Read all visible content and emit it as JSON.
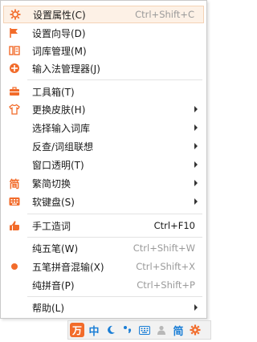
{
  "menu": {
    "items": [
      {
        "icon": "gear-icon",
        "label": "设置属性(C)",
        "shortcut": "Ctrl+Shift+C",
        "shortcut_dark": false,
        "submenu": false,
        "highlight": true
      },
      {
        "icon": "flag-icon",
        "label": "设置向导(D)",
        "shortcut": "",
        "shortcut_dark": false,
        "submenu": false,
        "highlight": false
      },
      {
        "icon": "dictionary-icon",
        "label": "词库管理(M)",
        "shortcut": "",
        "shortcut_dark": false,
        "submenu": false,
        "highlight": false
      },
      {
        "icon": "input-manager-icon",
        "label": "输入法管理器(J)",
        "shortcut": "",
        "shortcut_dark": false,
        "submenu": false,
        "highlight": false
      },
      {
        "icon": "toolbox-icon",
        "label": "工具箱(T)",
        "shortcut": "",
        "shortcut_dark": false,
        "submenu": false,
        "highlight": false
      },
      {
        "icon": "shirt-icon",
        "label": "更换皮肤(H)",
        "shortcut": "",
        "shortcut_dark": false,
        "submenu": true,
        "highlight": false
      },
      {
        "icon": "",
        "label": "选择输入词库",
        "shortcut": "",
        "shortcut_dark": false,
        "submenu": true,
        "highlight": false
      },
      {
        "icon": "",
        "label": "反查/词组联想",
        "shortcut": "",
        "shortcut_dark": false,
        "submenu": true,
        "highlight": false
      },
      {
        "icon": "",
        "label": "窗口透明(T)",
        "shortcut": "",
        "shortcut_dark": false,
        "submenu": true,
        "highlight": false
      },
      {
        "icon": "simplified-traditional-icon",
        "label": "繁简切换",
        "shortcut": "",
        "shortcut_dark": false,
        "submenu": true,
        "highlight": false
      },
      {
        "icon": "keyboard-icon",
        "label": "软键盘(S)",
        "shortcut": "",
        "shortcut_dark": false,
        "submenu": true,
        "highlight": false
      },
      {
        "icon": "hand-icon",
        "label": "手工造词",
        "shortcut": "Ctrl+F10",
        "shortcut_dark": true,
        "submenu": false,
        "highlight": false
      },
      {
        "icon": "",
        "label": "纯五笔(W)",
        "shortcut": "Ctrl+Shift+W",
        "shortcut_dark": false,
        "submenu": false,
        "highlight": false
      },
      {
        "icon": "selected-dot-icon",
        "label": "五笔拼音混输(X)",
        "shortcut": "Ctrl+Shift+X",
        "shortcut_dark": false,
        "submenu": false,
        "highlight": false
      },
      {
        "icon": "",
        "label": "纯拼音(P)",
        "shortcut": "Ctrl+Shift+P",
        "shortcut_dark": false,
        "submenu": false,
        "highlight": false
      },
      {
        "icon": "",
        "label": "帮助(L)",
        "shortcut": "",
        "shortcut_dark": false,
        "submenu": true,
        "highlight": false
      }
    ]
  },
  "statusbar": {
    "logo": "万",
    "lang": "中",
    "simplified": "简"
  },
  "colors": {
    "accent": "#f26b2a",
    "highlight_bg": "#fdf1e6",
    "status_blue": "#1a7ed6"
  }
}
